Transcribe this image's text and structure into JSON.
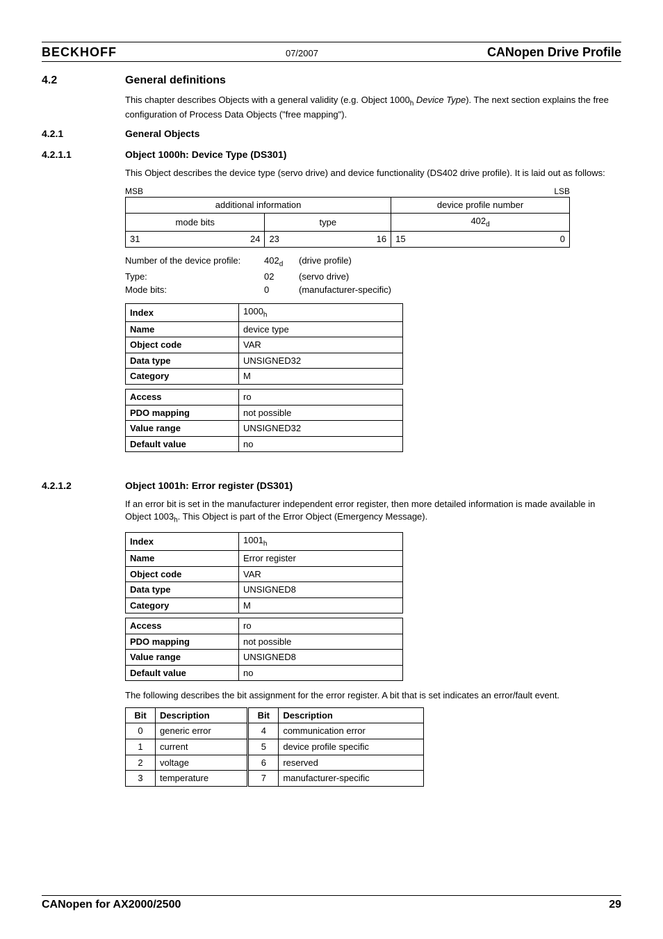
{
  "header": {
    "brand": "BECKHOFF",
    "date": "07/2007",
    "title": "CANopen Drive Profile"
  },
  "sec42": {
    "num": "4.2",
    "title": "General definitions",
    "intro_a": "This chapter describes Objects with a general  validity (e.g. Object 1000",
    "intro_b": " Device Type",
    "intro_c": "). The next section explains the free configuration of Process Data Objects (\"free mapping\")."
  },
  "sec421": {
    "num": "4.2.1",
    "title": "General Objects"
  },
  "sec4211": {
    "num": "4.2.1.1",
    "title": "Object 1000h: Device Type (DS301)",
    "para": "This Object describes the device type (servo drive) and device functionality (DS402 drive profile). It is laid out as follows:",
    "msb": "MSB",
    "lsb": "LSB",
    "layout": {
      "addl_info": "additional information",
      "dev_prof_num": "device profile number",
      "mode_bits": "mode bits",
      "type": "type",
      "v402d": "402",
      "d": "d"
    },
    "bits": {
      "b31": "31",
      "b24": "24",
      "b23": "23",
      "b16": "16",
      "b15": "15",
      "b0": "0"
    },
    "kv": [
      {
        "k": "Number of the device profile:",
        "v1": "402",
        "v1s": "d",
        "v2": "(drive profile)"
      },
      {
        "k": "Type:",
        "v1": "02",
        "v1s": "",
        "v2": "(servo drive)"
      },
      {
        "k": "Mode bits:",
        "v1": "0",
        "v1s": "",
        "v2": "(manufacturer-specific)"
      }
    ],
    "props1": [
      [
        "Index",
        "1000",
        "h"
      ],
      [
        "Name",
        "device type",
        ""
      ],
      [
        "Object code",
        "VAR",
        ""
      ],
      [
        "Data type",
        "UNSIGNED32",
        ""
      ],
      [
        "Category",
        "M",
        ""
      ]
    ],
    "props2": [
      [
        "Access",
        "ro"
      ],
      [
        "PDO mapping",
        "not possible"
      ],
      [
        "Value range",
        "UNSIGNED32"
      ],
      [
        "Default value",
        "no"
      ]
    ]
  },
  "sec4212": {
    "num": "4.2.1.2",
    "title": "Object 1001h: Error register (DS301)",
    "para_a": "If an error bit is set in the manufacturer independent error register, then more detailed information is made available in Object 1003",
    "para_b": ". This Object is part of the Error Object (Emergency Message).",
    "props1": [
      [
        "Index",
        "1001",
        "h"
      ],
      [
        "Name",
        "Error register",
        ""
      ],
      [
        "Object code",
        "VAR",
        ""
      ],
      [
        "Data type",
        "UNSIGNED8",
        ""
      ],
      [
        "Category",
        "M",
        ""
      ]
    ],
    "props2": [
      [
        "Access",
        "ro"
      ],
      [
        "PDO mapping",
        "not possible"
      ],
      [
        "Value range",
        "UNSIGNED8"
      ],
      [
        "Default value",
        "no"
      ]
    ],
    "bitdesc": "The following describes the bit assignment for the error register. A bit that is set indicates an error/fault event.",
    "bit_hdr": {
      "bit": "Bit",
      "desc": "Description"
    },
    "bit_rows": [
      [
        "0",
        "generic error",
        "4",
        "communication error"
      ],
      [
        "1",
        "current",
        "5",
        "device profile specific"
      ],
      [
        "2",
        "voltage",
        "6",
        "reserved"
      ],
      [
        "3",
        "temperature",
        "7",
        "manufacturer-specific"
      ]
    ]
  },
  "footer": {
    "left": "CANopen for AX2000/2500",
    "right": "29"
  }
}
